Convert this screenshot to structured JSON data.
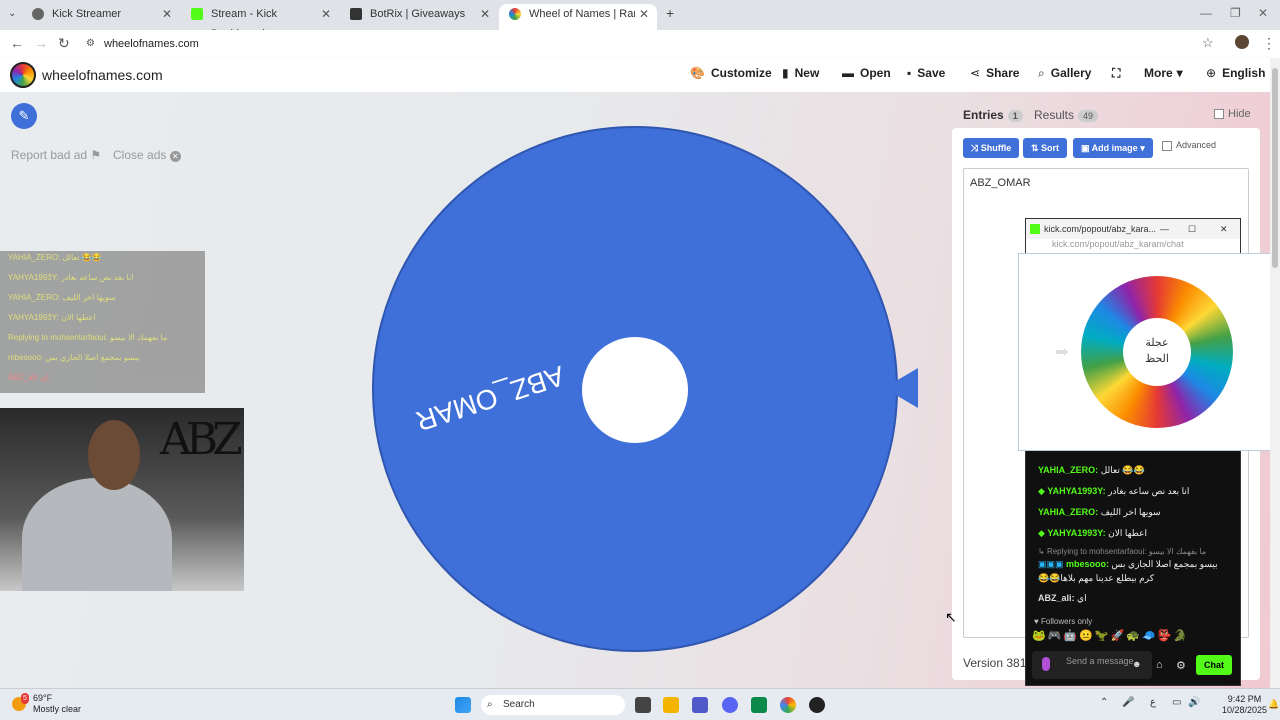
{
  "browser": {
    "tabs": [
      {
        "label": "Kick Streamer",
        "active": false
      },
      {
        "label": "Stream - Kick Dashboard",
        "active": false
      },
      {
        "label": "BotRix | Giveaways",
        "active": false
      },
      {
        "label": "Wheel of Names | Random nam",
        "active": true
      }
    ],
    "new_tab": "+",
    "url": "wheelofnames.com"
  },
  "site": {
    "logo_text": "wheelofnames.com",
    "menu": {
      "customize": "Customize",
      "new": "New",
      "open": "Open",
      "save": "Save",
      "share": "Share",
      "gallery": "Gallery",
      "more": "More",
      "language": "English"
    },
    "report_ad": "Report bad ad",
    "close_ads": "Close ads",
    "wheel_entry": "ABZ_OMAR"
  },
  "panel": {
    "entries_label": "Entries",
    "entries_count": "1",
    "results_label": "Results",
    "results_count": "49",
    "hide_label": "Hide",
    "shuffle": "Shuffle",
    "sort": "Sort",
    "add_image": "Add image",
    "advanced": "Advanced",
    "entries_text": "ABZ_OMAR",
    "version": "Version 381"
  },
  "kick_popout": {
    "title": "kick.com/popout/abz_kara...",
    "url": "kick.com/popout/abz_karam/chat",
    "messages": [
      {
        "user": "YAHIA_ZERO:",
        "text": "تعالل 😂😂",
        "color": "#53fc18"
      },
      {
        "user": "YAHYA1993Y:",
        "text": "انا بعد نص ساعه بغادر",
        "color": "#53fc18"
      },
      {
        "user": "YAHIA_ZERO:",
        "text": "سويها اخر الليف",
        "color": "#53fc18"
      },
      {
        "user": "YAHYA1993Y:",
        "text": "اعطها الان",
        "color": "#53fc18"
      },
      {
        "user": "Replying to mohsentarfaoui:",
        "text": "ما بفهمك الا بيسو",
        "color": "#888888"
      },
      {
        "user": "mbesooo:",
        "text": "بيسو بمجمع اصلا الجازي بس",
        "color": "#53fc18"
      },
      {
        "user": "",
        "text": "😂😂كرم بيطلع عدينا مهم بلاها",
        "color": "#ffffff"
      },
      {
        "user": "ABZ_ali:",
        "text": "اي",
        "color": "#dddddd"
      }
    ],
    "followers_only": "Followers only",
    "send_placeholder": "Send a message",
    "chat_button": "Chat"
  },
  "overlay_chat": [
    "YAHIA_ZERO: تعالل 😂😂",
    "YAHYA1993Y: انا بعد نص ساعه بغادر",
    "YAHIA_ZERO: سويها اخر الليف",
    "YAHYA1993Y: اعطها الان",
    "Replying to mohsentarfaoui: ما بفهمك الا بيسو",
    "mbesooo: بيسو بمجمع اصلا الجازي بس",
    "ABZ_ali: اي"
  ],
  "webcam_wall_text": "ABZ",
  "wheel_preview": {
    "center_line1": "عجلة",
    "center_line2": "الحظ"
  },
  "taskbar": {
    "weather_temp": "69°F",
    "weather_desc": "Mostly clear",
    "weather_badge": "5",
    "search": "Search",
    "time": "9:42 PM",
    "date": "10/28/2025"
  },
  "colors": {
    "wheel_blue": "#3f6fd8",
    "kick_green": "#53fc18"
  }
}
